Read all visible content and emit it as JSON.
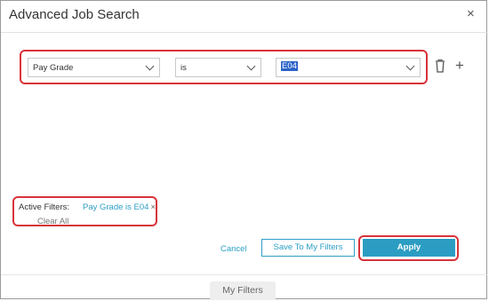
{
  "dialog": {
    "title": "Advanced Job Search",
    "close_icon": "close-icon",
    "close_glyph": "×"
  },
  "filter_row": {
    "field": {
      "value": "Pay Grade"
    },
    "operator": {
      "value": "is"
    },
    "value": {
      "value": "E04"
    },
    "delete_icon": "trash-icon",
    "add_icon": "plus-icon",
    "add_glyph": "+"
  },
  "active_filters": {
    "label": "Active Filters:",
    "chips": [
      {
        "text": "Pay Grade is E04",
        "remove_glyph": "×"
      }
    ],
    "clear_all": "Clear All"
  },
  "actions": {
    "cancel": "Cancel",
    "save": "Save To My Filters",
    "apply": "Apply"
  },
  "bottom_tab": {
    "label": "My Filters"
  },
  "colors": {
    "accent": "#2e9fc6",
    "apply_bg": "#2c9dc2",
    "highlight_border": "#d8333a",
    "text_selection": "#2c64c8"
  }
}
